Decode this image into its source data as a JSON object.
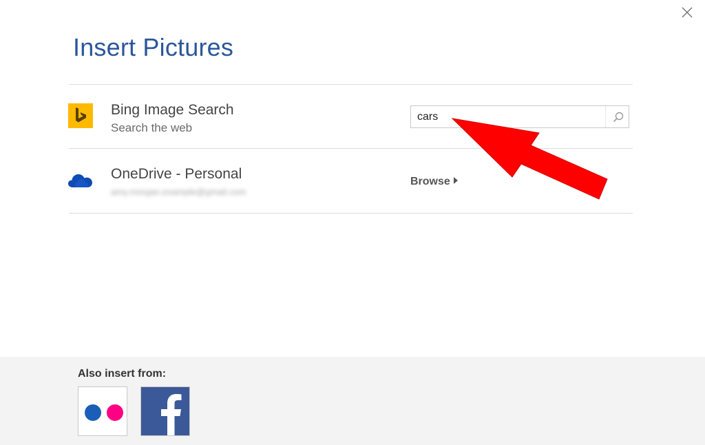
{
  "dialog": {
    "title": "Insert Pictures",
    "close_icon": "close-icon"
  },
  "sources": [
    {
      "name": "Bing Image Search",
      "subtitle": "Search the web",
      "icon": "bing-logo-icon",
      "icon_color": "#ffb900",
      "search": {
        "value": "cars",
        "button_icon": "search-icon"
      }
    },
    {
      "name": "OneDrive - Personal",
      "account_email": "amy.morgan.example@gmail.com",
      "icon": "onedrive-cloud-icon",
      "icon_color": "#0f4bb5",
      "browse_label": "Browse",
      "browse_icon": "caret-right-icon"
    }
  ],
  "annotation": {
    "icon": "red-arrow-icon",
    "color": "#ff0000"
  },
  "footer": {
    "label": "Also insert from:",
    "services": [
      {
        "name": "Flickr",
        "icon": "flickr-icon",
        "colors": [
          "#0063dc",
          "#ff0084"
        ]
      },
      {
        "name": "Facebook",
        "icon": "facebook-icon",
        "color": "#3b5998"
      }
    ]
  },
  "colors": {
    "title": "#2b579a",
    "footer_bg": "#f3f3f3"
  }
}
